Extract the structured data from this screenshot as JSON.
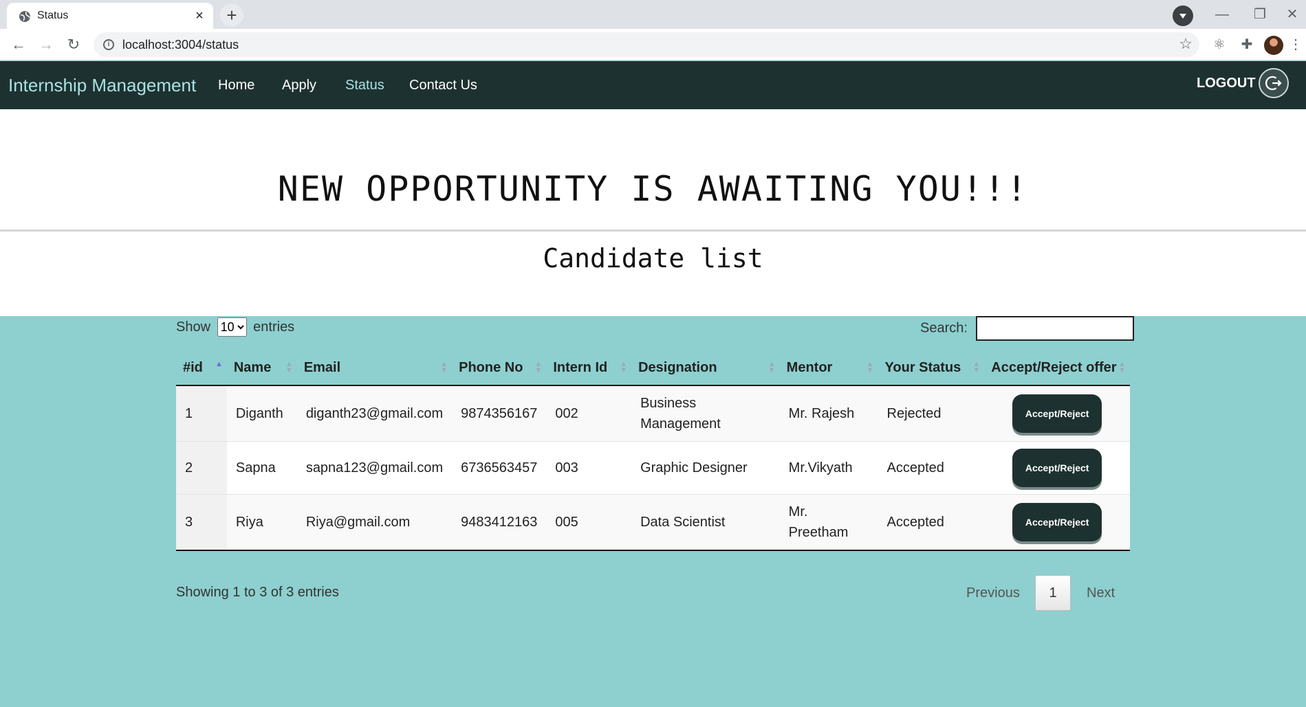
{
  "browser": {
    "tab_title": "Status",
    "tab_close": "×",
    "new_tab": "+",
    "url": "localhost:3004/status",
    "minimize": "—",
    "restore": "❐",
    "close_window": "✕"
  },
  "navbar": {
    "brand": "Internship Management",
    "links": [
      {
        "label": "Home"
      },
      {
        "label": "Apply"
      },
      {
        "label": "Status"
      },
      {
        "label": "Contact Us"
      }
    ],
    "logout": "LOGOUT"
  },
  "hero": {
    "headline": "NEW OPPORTUNITY IS AWAITING YOU!!!",
    "subhead": "Candidate list"
  },
  "table_controls": {
    "show_label": "Show",
    "entries_label": "entries",
    "page_size": "10",
    "search_label": "Search:",
    "search_value": ""
  },
  "table": {
    "columns": [
      "#id",
      "Name",
      "Email",
      "Phone No",
      "Intern Id",
      "Designation",
      "Mentor",
      "Your Status",
      "Accept/Reject offer"
    ],
    "rows": [
      {
        "id": "1",
        "name": "Diganth",
        "email": "diganth23@gmail.com",
        "phone": "9874356167",
        "intern_id": "002",
        "designation": "Business Management",
        "mentor": "Mr. Rajesh",
        "status": "Rejected",
        "action": "Accept/Reject"
      },
      {
        "id": "2",
        "name": "Sapna",
        "email": "sapna123@gmail.com",
        "phone": "6736563457",
        "intern_id": "003",
        "designation": "Graphic Designer",
        "mentor": "Mr.Vikyath",
        "status": "Accepted",
        "action": "Accept/Reject"
      },
      {
        "id": "3",
        "name": "Riya",
        "email": "Riya@gmail.com",
        "phone": "9483412163",
        "intern_id": "005",
        "designation": "Data Scientist",
        "mentor": "Mr. Preetham",
        "status": "Accepted",
        "action": "Accept/Reject"
      }
    ]
  },
  "footer": {
    "info": "Showing 1 to 3 of 3 entries",
    "previous": "Previous",
    "page": "1",
    "next": "Next"
  },
  "colors": {
    "navbar_bg": "#1e3131",
    "brand": "#a7e3e0",
    "page_bg": "#8ecfcf",
    "button_bg": "#1e3131"
  }
}
